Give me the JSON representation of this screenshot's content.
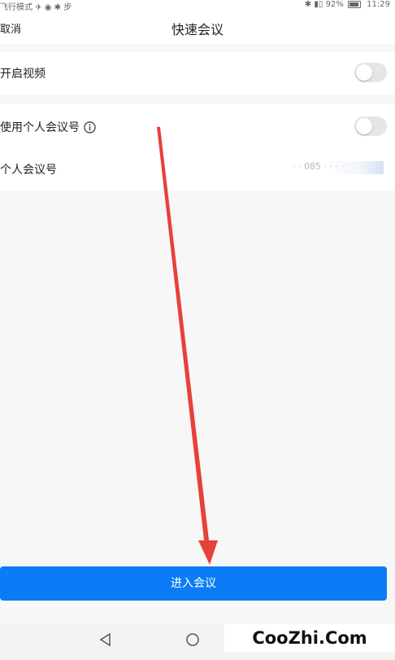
{
  "status_bar": {
    "left_text": "飞行模式 ✈ ◉ ✱ 步",
    "battery_percent_text": "92%",
    "battery_level": 0.92,
    "time": "11:29",
    "icons": [
      "airplane-mode-icon",
      "bluetooth-icon",
      "battery-icon"
    ]
  },
  "header": {
    "cancel_label": "取消",
    "title": "快速会议"
  },
  "settings": {
    "video": {
      "label": "开启视频",
      "toggle_on": false
    },
    "personal_id_toggle": {
      "label": "使用个人会议号",
      "icon": "info-icon",
      "toggle_on": false
    },
    "personal_id": {
      "label": "个人会议号",
      "value": "· · 085 · · · ·"
    }
  },
  "join_button": {
    "label": "进入会议"
  },
  "nav": {
    "back_icon": "nav-back-icon",
    "home_icon": "nav-home-icon"
  },
  "watermark": {
    "text": "CooZhi.Com"
  },
  "colors": {
    "accent": "#0b7cf5",
    "background": "#f7f7f7",
    "card": "#ffffff",
    "toggle_off": "#e6e6e6",
    "annotation_arrow": "#e8403a"
  }
}
